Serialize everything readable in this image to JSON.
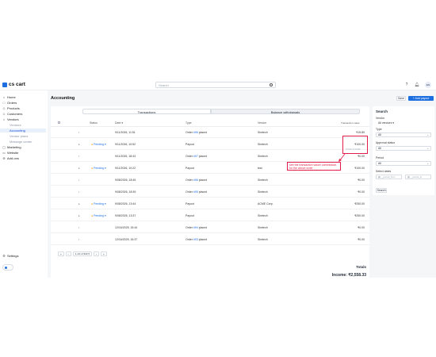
{
  "app": {
    "logo_text": "cs cart",
    "brand_color": "#1d6fe0"
  },
  "topbar": {
    "search_placeholder": "Search",
    "avatar": "EN",
    "help_icon": "question-icon",
    "bell_icon": "bell-icon"
  },
  "sidebar": {
    "items": [
      {
        "label": "Home",
        "icon": "home-icon"
      },
      {
        "label": "Orders",
        "icon": "orders-icon"
      },
      {
        "label": "Products",
        "icon": "products-icon"
      },
      {
        "label": "Customers",
        "icon": "customers-icon"
      },
      {
        "label": "Vendors",
        "icon": "vendors-icon"
      },
      {
        "label": "Vendors"
      },
      {
        "label": "Accounting"
      },
      {
        "label": "Vendor plans"
      },
      {
        "label": "Message center"
      },
      {
        "label": "Marketing",
        "icon": "marketing-icon"
      },
      {
        "label": "Website",
        "icon": "website-icon"
      },
      {
        "label": "Add-ons",
        "icon": "addons-icon"
      }
    ],
    "settings": "Settings"
  },
  "page": {
    "title": "Accounting",
    "save": "Save",
    "add_payout": "+ Add payout"
  },
  "tabs": [
    "Transactions",
    "Balance withdrawals"
  ],
  "table": {
    "headers": {
      "status": "Status",
      "date": "Date ▾",
      "type": "Type",
      "vendor": "Vendor",
      "value": "Transaction value"
    },
    "rows": [
      {
        "dot": "•",
        "status": "",
        "date": "9/11/2026, 11:51",
        "type_pre": "Order ",
        "type_link": "#96",
        "type_post": " placed",
        "vendor": "Simtech",
        "amount": "₹15.89"
      },
      {
        "dot": "▸",
        "status": "Pending ▾",
        "date": "9/11/2026, 10:52",
        "type_pre": "Payout",
        "type_link": "",
        "type_post": "",
        "vendor": "Simtech",
        "amount": "₹100.00"
      },
      {
        "dot": "•",
        "status": "",
        "date": "9/11/2026, 18:43",
        "type_pre": "Order ",
        "type_link": "#97",
        "type_post": " placed",
        "vendor": "Simtech",
        "amount": "₹0.00"
      },
      {
        "dot": "▸",
        "status": "Pending ▾",
        "date": "9/11/2026, 10:22",
        "type_pre": "Payout",
        "type_link": "",
        "type_post": "",
        "vendor": "test",
        "amount": "₹100.00"
      },
      {
        "dot": "•",
        "status": "",
        "date": "9/08/2026, 18:45",
        "type_pre": "Order ",
        "type_link": "#96",
        "type_post": " placed",
        "vendor": "Simtech",
        "amount": "₹0.00"
      },
      {
        "dot": "•",
        "status": "",
        "date": "9/08/2026, 18:39",
        "type_pre": "Order ",
        "type_link": "#95",
        "type_post": " placed",
        "vendor": "Simtech",
        "amount": "₹0.00"
      },
      {
        "dot": "▸",
        "status": "Pending ▾",
        "date": "9/08/2026, 13:44",
        "type_pre": "Payout",
        "type_link": "",
        "type_post": "",
        "vendor": "ACME Corp.",
        "amount": "₹250.00"
      },
      {
        "dot": "▸",
        "status": "Pending ▾",
        "date": "9/08/2026, 13:37",
        "type_pre": "Payout",
        "type_link": "",
        "type_post": "",
        "vendor": "Simtech",
        "amount": "₹250.00"
      },
      {
        "dot": "•",
        "status": "",
        "date": "12/16/2025, 15:44",
        "type_pre": "Order ",
        "type_link": "#94",
        "type_post": " placed",
        "vendor": "Simtech",
        "amount": "₹0.00"
      },
      {
        "dot": "•",
        "status": "",
        "date": "12/16/2025, 15:37",
        "type_pre": "Order ",
        "type_link": "#93",
        "type_post": " placed",
        "vendor": "Simtech",
        "amount": "₹0.00"
      }
    ],
    "highlight_sub": "₹ 0.00 / ₹ 15.89",
    "annotation": "see the transaction value/ commission for the above order"
  },
  "pager": [
    "«",
    "‹",
    "1–10 of 343 ▾",
    "›",
    "»"
  ],
  "totals": {
    "title": "Totals",
    "income": "Income: ₹2,558.33"
  },
  "search_panel": {
    "title": "Search",
    "vendor_label": "Vendor",
    "vendor_value": "All vendors ▾",
    "type_label": "Type",
    "type_value": "All",
    "approval_label": "Approval status",
    "approval_value": "All",
    "period_label": "Period",
    "period_value": "All",
    "dates_label": "Select dates",
    "date_from": "__period_from",
    "date_to": "__period_to",
    "button": "Search"
  }
}
